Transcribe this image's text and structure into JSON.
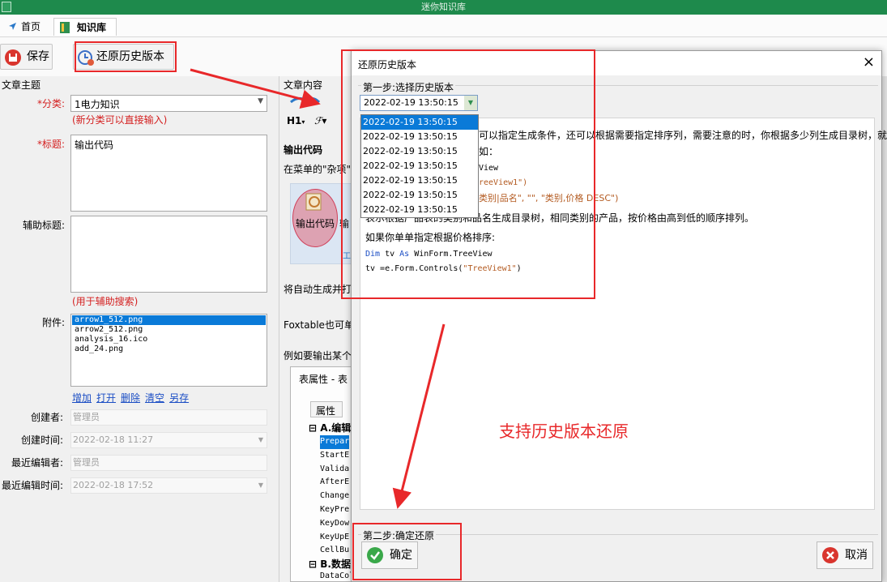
{
  "app": {
    "title": "迷你知识库"
  },
  "tabs": [
    {
      "label": "首页"
    },
    {
      "label": "知识库"
    }
  ],
  "toolbar": {
    "save_label": "保存",
    "restore_label": "还原历史版本"
  },
  "left": {
    "section_title": "文章主题",
    "category_label": "*分类:",
    "category_value": "1电力知识",
    "category_hint": "(新分类可以直接输入)",
    "title_label": "*标题:",
    "title_value": "输出代码",
    "subtitle_label": "辅助标题:",
    "subtitle_hint": "(用于辅助搜索)",
    "attachment_label": "附件:",
    "attachments": [
      "arrow1_512.png",
      "arrow2_512.png",
      "analysis_16.ico",
      "add_24.png"
    ],
    "attachment_actions": [
      "增加",
      "打开",
      "删除",
      "清空",
      "另存"
    ],
    "creator_label": "创建者:",
    "creator_value": "管理员",
    "created_time_label": "创建时间:",
    "created_time_value": "2022-02-18 11:27",
    "last_editor_label": "最近编辑者:",
    "last_editor_value": "管理员",
    "last_edit_time_label": "最近编辑时间:",
    "last_edit_time_value": "2022-02-18 17:52"
  },
  "content": {
    "section_title": "文章内容",
    "format_h1": "H1",
    "heading": "输出代码",
    "line1": "在菜单的\"杂项\"",
    "image_caption": "输出代码",
    "image_caption2": "输",
    "image_footer": "工",
    "para2": "将自动生成并打",
    "para3": "Foxtable也可单",
    "para4": "例如要输出某个",
    "prop_window_title": "表属性 - 表",
    "prop_tab": "属性",
    "prop_group_a": "A.编辑",
    "prop_items": [
      "Prepar",
      "StartE",
      "Valida",
      "AfterE",
      "Change",
      "KeyPre",
      "KeyDow",
      "KeyUpE",
      "CellBu"
    ],
    "prop_group_b": "B.数据",
    "prop_last_item": "DataColChanging"
  },
  "dialog": {
    "title": "还原历史版本",
    "close_glyph": "×",
    "step1_label": "第一步:选择历史版本",
    "selected_version": "2022-02-19 13:50:15",
    "versions": [
      "2022-02-19 13:50:15",
      "2022-02-19 13:50:15",
      "2022-02-19 13:50:15",
      "2022-02-19 13:50:15",
      "2022-02-19 13:50:15",
      "2022-02-19 13:50:15",
      "2022-02-19 13:50:15"
    ],
    "preview": {
      "line1": "可以指定生成条件，还可以根据需要指定排序列，需要注意的时，你根据多少列生成目录树，就",
      "line2": "如：",
      "line3": "View",
      "line4": "reeView1\")",
      "line5": "类别|品名\", \"\", \"类别,价格 DESC\")",
      "line6": "表示根据产品表的类别和品名生成目录树，相同类别的产品，按价格由高到低的顺序排列。",
      "line7": "如果你单单指定根据价格排序:",
      "code1_kw1": "Dim",
      "code1_mid": " tv ",
      "code1_kw2": "As",
      "code1_rest": " WinForm.TreeView",
      "code2_a": "tv =e.Form.Controls(",
      "code2_str": "\"TreeView1\"",
      "code2_b": ")"
    },
    "step2_label": "第二步:确定还原",
    "confirm_label": "确定",
    "cancel_label": "取消"
  },
  "annotation": {
    "text": "支持历史版本还原"
  },
  "colors": {
    "titlebar": "#1e8a4c",
    "accent_red": "#e8282a",
    "selection": "#0a7ad8",
    "link": "#1a4dc4"
  }
}
